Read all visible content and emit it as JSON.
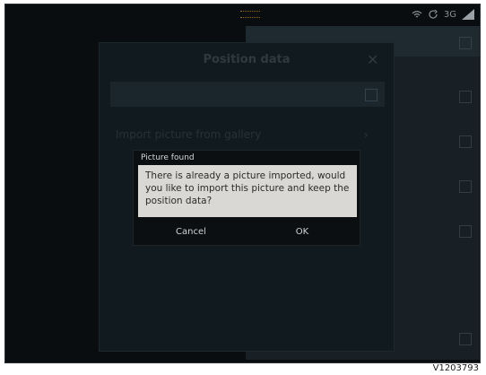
{
  "screen": {
    "status_bar": {
      "network_label": "3G",
      "icons": [
        "wifi-icon",
        "refresh-icon",
        "signal-icon"
      ]
    },
    "background_dialog": {
      "title": "Position data",
      "close_icon": "close-icon",
      "faint_row_text": "Import picture from gallery"
    },
    "modal": {
      "title": "Picture found",
      "message": "There is already a picture imported, would you like to import this picture and keep the position data?",
      "buttons": {
        "cancel": "Cancel",
        "ok": "OK"
      }
    }
  },
  "caption": "V1203793"
}
